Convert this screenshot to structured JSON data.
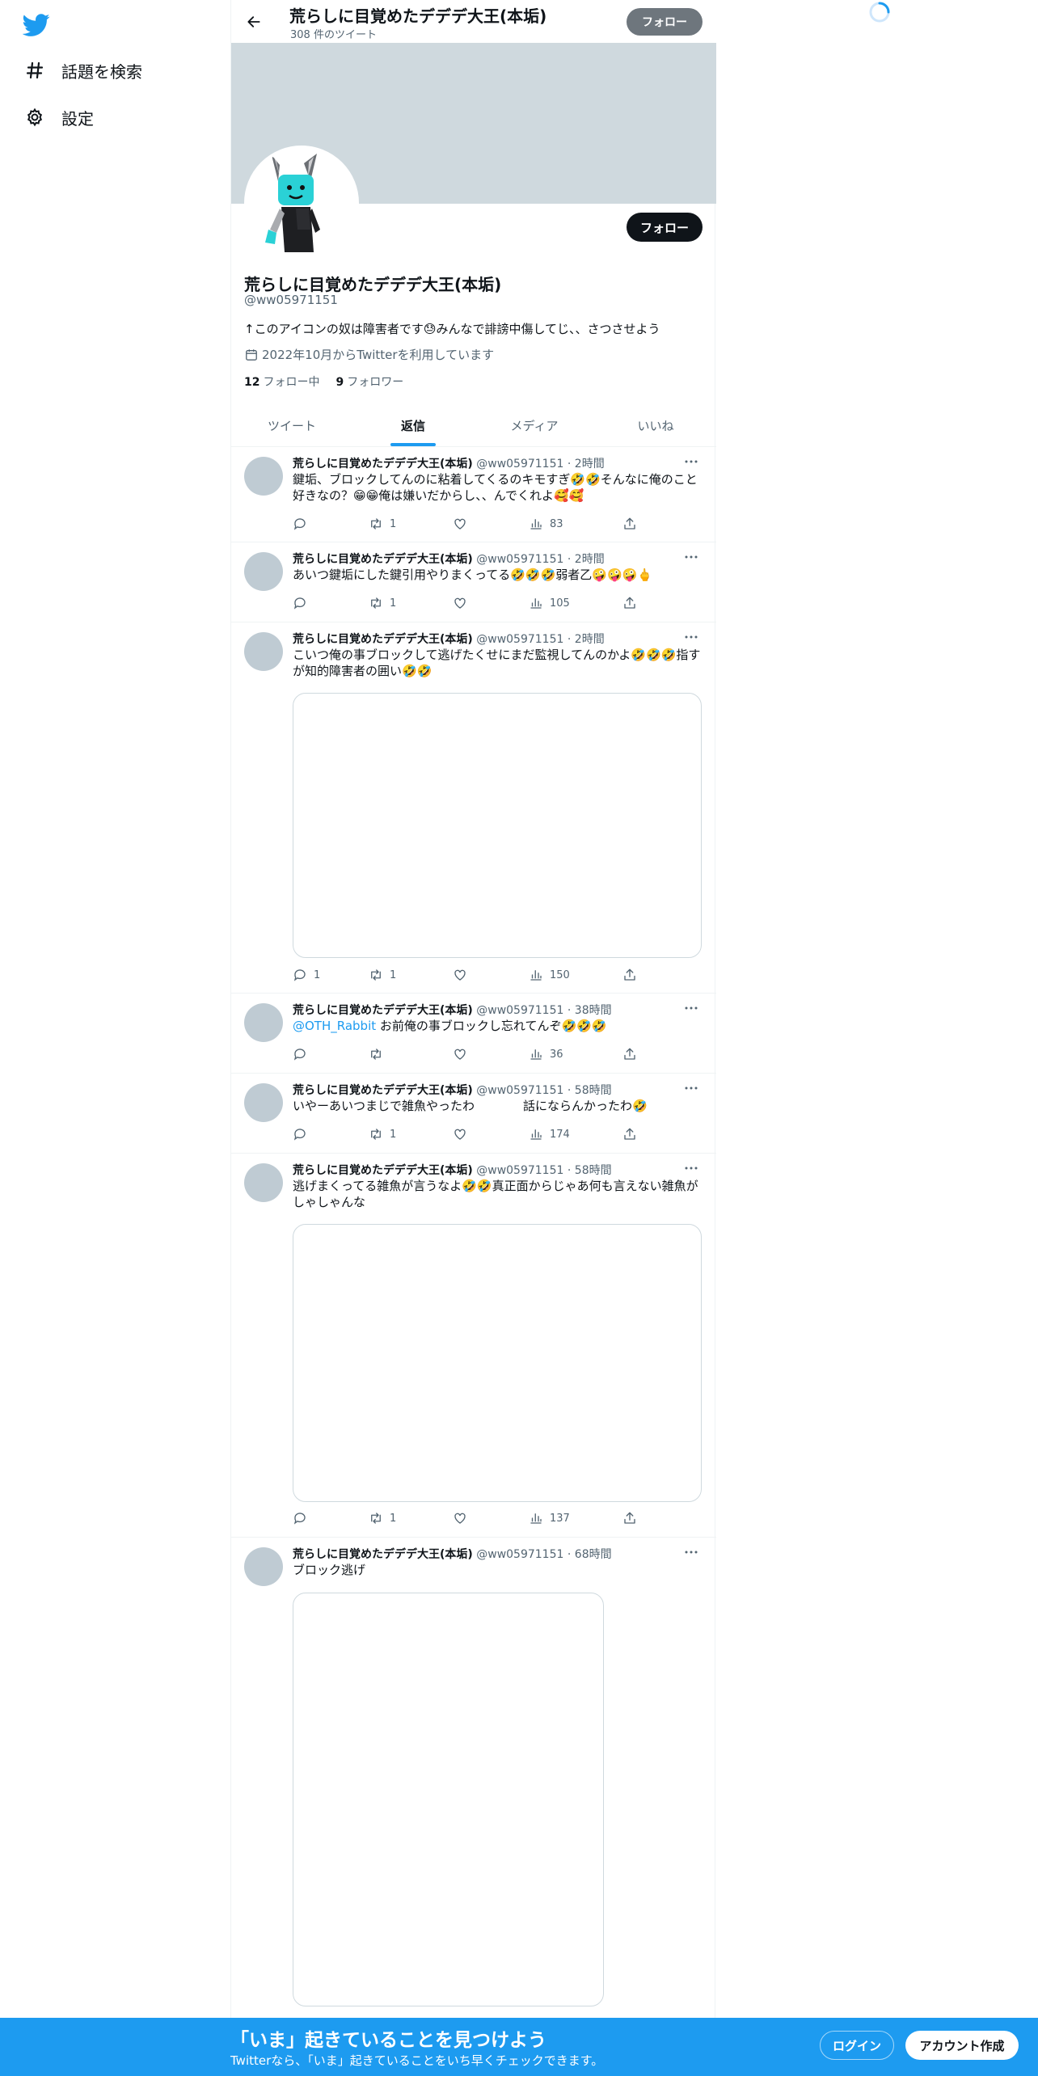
{
  "nav": {
    "items": [
      {
        "label": "話題を検索",
        "icon": "hashtag-icon"
      },
      {
        "label": "設定",
        "icon": "gear-icon"
      }
    ]
  },
  "header": {
    "title": "荒らしに目覚めたデデデ大王(本垢)",
    "subtitle": "308 件のツイート",
    "follow_label": "フォロー"
  },
  "profile": {
    "name": "荒らしに目覚めたデデデ大王(本垢)",
    "handle": "@ww05971151",
    "bio": "↑このアイコンの奴は障害者です😓みんなで誹謗中傷してじ、、さつさせよう",
    "joined": "2022年10月からTwitterを利用しています",
    "following_count": "12",
    "following_label": "フォロー中",
    "followers_count": "9",
    "followers_label": "フォロワー",
    "follow_label": "フォロー"
  },
  "tabs": [
    {
      "label": "ツイート",
      "active": false
    },
    {
      "label": "返信",
      "active": true
    },
    {
      "label": "メディア",
      "active": false
    },
    {
      "label": "いいね",
      "active": false
    }
  ],
  "tweets": [
    {
      "name": "荒らしに目覚めたデデデ大王(本垢)",
      "handle": "@ww05971151",
      "dot": "·",
      "time": "2時間",
      "text": "鍵垢、ブロックしてんのに粘着してくるのキモすぎ🤣🤣そんなに俺のこと好きなの？😁😁俺は嫌いだからし、、んでくれよ🥰🥰",
      "mention": "",
      "replies": "",
      "retweets": "1",
      "likes": "",
      "views": "83"
    },
    {
      "name": "荒らしに目覚めたデデデ大王(本垢)",
      "handle": "@ww05971151",
      "dot": "·",
      "time": "2時間",
      "text": "あいつ鍵垢にした鍵引用やりまくってる🤣🤣🤣弱者乙🤪🤪🤪🖕",
      "mention": "",
      "replies": "",
      "retweets": "1",
      "likes": "",
      "views": "105"
    },
    {
      "name": "荒らしに目覚めたデデデ大王(本垢)",
      "handle": "@ww05971151",
      "dot": "·",
      "time": "2時間",
      "text": "こいつ俺の事ブロックして逃げたくせにまだ監視してんのかよ🤣🤣🤣指すが知的障害者の囲い🤣🤣",
      "mention": "",
      "replies": "1",
      "retweets": "1",
      "likes": "",
      "views": "150"
    },
    {
      "name": "荒らしに目覚めたデデデ大王(本垢)",
      "handle": "@ww05971151",
      "dot": "·",
      "time": "38時間",
      "text": "お前俺の事ブロックし忘れてんぞ🤣🤣🤣",
      "mention": "@OTH_Rabbit",
      "replies": "",
      "retweets": "",
      "likes": "",
      "views": "36"
    },
    {
      "name": "荒らしに目覚めたデデデ大王(本垢)",
      "handle": "@ww05971151",
      "dot": "·",
      "time": "58時間",
      "text": "いやーあいつまじで雑魚やったわ　　　　話にならんかったわ🤣",
      "mention": "",
      "replies": "",
      "retweets": "1",
      "likes": "",
      "views": "174"
    },
    {
      "name": "荒らしに目覚めたデデデ大王(本垢)",
      "handle": "@ww05971151",
      "dot": "·",
      "time": "58時間",
      "text": "逃げまくってる雑魚が言うなよ🤣🤣真正面からじゃあ何も言えない雑魚がしゃしゃんな",
      "mention": "",
      "replies": "",
      "retweets": "1",
      "likes": "",
      "views": "137"
    },
    {
      "name": "荒らしに目覚めたデデデ大王(本垢)",
      "handle": "@ww05971151",
      "dot": "·",
      "time": "68時間",
      "text": "ブロック逃げ",
      "mention": "",
      "replies": "",
      "retweets": "",
      "likes": "",
      "views": ""
    }
  ],
  "bottom_bar": {
    "title": "「いま」起きていることを見つけよう",
    "subtitle": "Twitterなら、「いま」起きていることをいち早くチェックできます。",
    "login_label": "ログイン",
    "signup_label": "アカウント作成"
  },
  "colors": {
    "accent": "#1d9bf0",
    "banner": "#cfd9de",
    "text": "#0f1419",
    "muted": "#536471"
  }
}
